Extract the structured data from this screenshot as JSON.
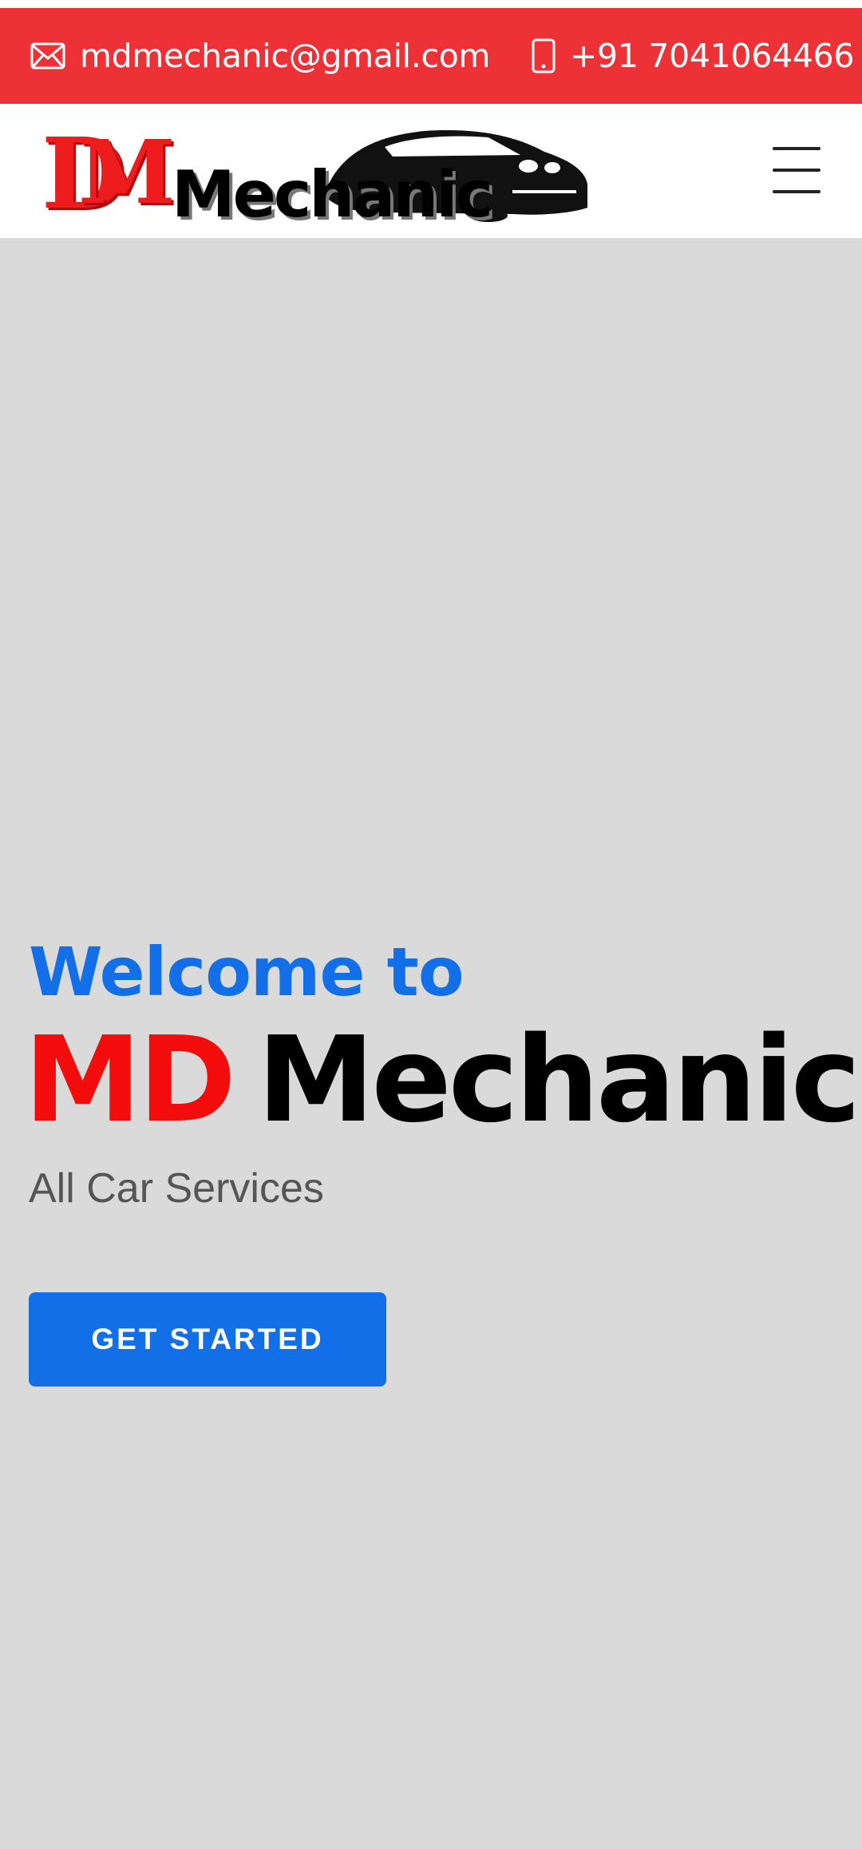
{
  "topbar": {
    "email": "mdmechanic@gmail.com",
    "phone": "+91 7041064466",
    "email_icon": "envelope-icon",
    "phone_icon": "mobile-phone-icon",
    "background_color": "#ed3237"
  },
  "navbar": {
    "logo": {
      "monogram": "MD",
      "wordmark": "Mechanic",
      "graphic": "car-silhouette"
    },
    "menu_icon": "hamburger-menu-icon"
  },
  "hero": {
    "welcome": "Welcome to",
    "brand_primary": "MD",
    "brand_secondary": "Mechanic",
    "tagline": "All Car Services",
    "cta_label": "GET STARTED",
    "colors": {
      "accent_blue": "#126fe8",
      "accent_red": "#f20c0c",
      "background": "#dadada"
    }
  }
}
